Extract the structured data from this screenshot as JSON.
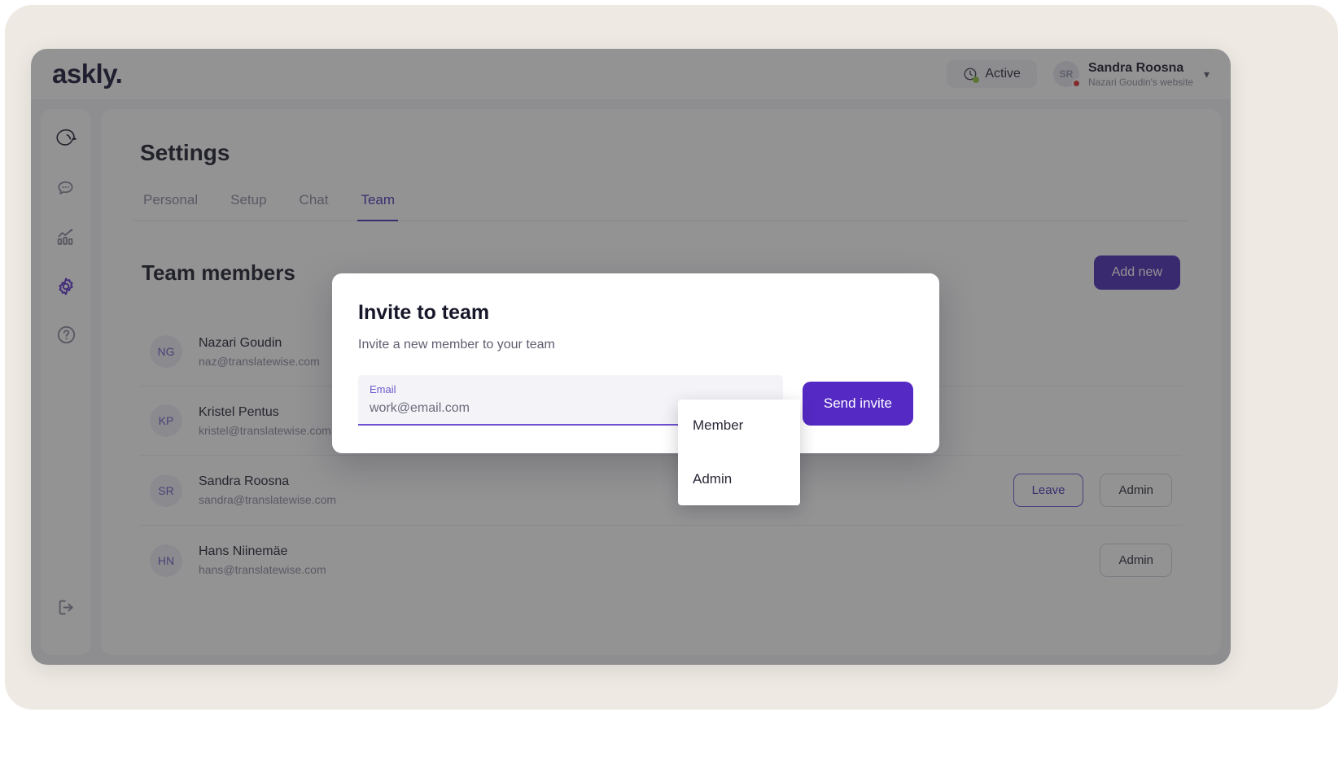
{
  "app": {
    "logo": "askly.",
    "status_label": "Active",
    "status_icon": "clock-icon",
    "status_dot_color": "#8ec641",
    "user": {
      "initials": "SR",
      "name": "Sandra Roosna",
      "site": "Nazari Goudin's website",
      "presence_color": "#e13030"
    },
    "chevron": "▾"
  },
  "sidebar": {
    "items": [
      {
        "icon": "askly-brand-icon",
        "name": "brand",
        "active": false
      },
      {
        "icon": "chat-bubble-icon",
        "name": "conversations",
        "active": false
      },
      {
        "icon": "analytics-chart-icon",
        "name": "statistics",
        "active": false
      },
      {
        "icon": "gear-icon",
        "name": "settings",
        "active": true
      },
      {
        "icon": "question-circle-icon",
        "name": "help",
        "active": false
      }
    ],
    "logout_icon": "logout-icon"
  },
  "main": {
    "page_title": "Settings",
    "tabs": [
      {
        "label": "Personal",
        "active": false
      },
      {
        "label": "Setup",
        "active": false
      },
      {
        "label": "Chat",
        "active": false
      },
      {
        "label": "Team",
        "active": true
      }
    ],
    "section_title": "Team members",
    "add_new_label": "Add new",
    "members": [
      {
        "initials": "NG",
        "name": "Nazari Goudin",
        "email": "naz@translatewise.com",
        "leave": null,
        "role": null
      },
      {
        "initials": "KP",
        "name": "Kristel Pentus",
        "email": "kristel@translatewise.com",
        "leave": null,
        "role": null
      },
      {
        "initials": "SR",
        "name": "Sandra Roosna",
        "email": "sandra@translatewise.com",
        "leave": "Leave",
        "role": "Admin"
      },
      {
        "initials": "HN",
        "name": "Hans Niinemäe",
        "email": "hans@translatewise.com",
        "leave": null,
        "role": "Admin"
      }
    ]
  },
  "modal": {
    "title": "Invite to team",
    "subtitle": "Invite a new member to your team",
    "email_label": "Email",
    "email_placeholder": "work@email.com",
    "email_value": "",
    "role_selected": "Member",
    "send_label": "Send invite",
    "role_options": [
      {
        "label": "Member"
      },
      {
        "label": "Admin"
      }
    ]
  },
  "colors": {
    "accent_purple": "#5429c4",
    "accent_purple_dark": "#4b2bb5",
    "link_purple": "#4b32b3",
    "page_cream": "#eeeae3",
    "scrim": "rgba(40,40,42,.50)"
  }
}
